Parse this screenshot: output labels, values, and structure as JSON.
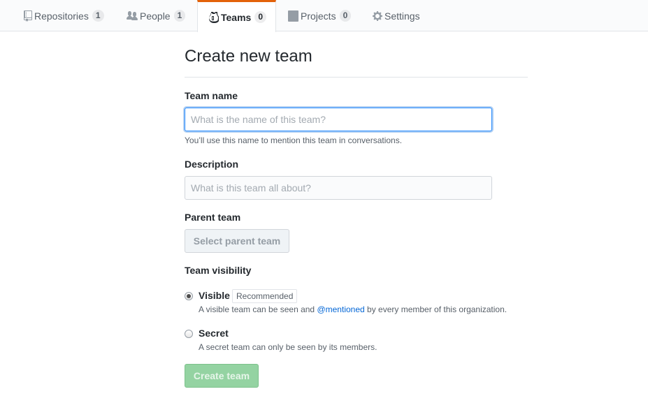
{
  "tabs": [
    {
      "label": "Repositories",
      "count": "1",
      "icon": "repo-icon",
      "selected": false
    },
    {
      "label": "People",
      "count": "1",
      "icon": "people-icon",
      "selected": false
    },
    {
      "label": "Teams",
      "count": "0",
      "icon": "jersey-icon",
      "selected": true
    },
    {
      "label": "Projects",
      "count": "0",
      "icon": "project-icon",
      "selected": false
    },
    {
      "label": "Settings",
      "icon": "gear-icon",
      "selected": false
    }
  ],
  "page": {
    "title": "Create new team"
  },
  "form": {
    "team_name": {
      "label": "Team name",
      "placeholder": "What is the name of this team?",
      "value": "",
      "note": "You’ll use this name to mention this team in conversations."
    },
    "description": {
      "label": "Description",
      "placeholder": "What is this team all about?",
      "value": ""
    },
    "parent_team": {
      "label": "Parent team",
      "button_label": "Select parent team"
    },
    "visibility": {
      "label": "Team visibility",
      "options": [
        {
          "title": "Visible",
          "badge": "Recommended",
          "desc_before": "A visible team can be seen and ",
          "desc_link": "@mentioned",
          "desc_after": " by every member of this organization.",
          "checked": true
        },
        {
          "title": "Secret",
          "desc": "A secret team can only be seen by its members.",
          "checked": false
        }
      ]
    },
    "submit_label": "Create team"
  },
  "colors": {
    "accent": "#e36209",
    "link": "#0366d6",
    "primary_disabled": "#94d3a2",
    "focus": "#2188ff"
  }
}
